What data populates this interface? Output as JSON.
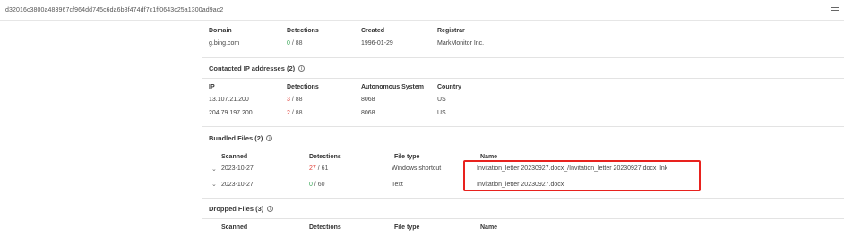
{
  "header": {
    "hash": "d32016c3800a483967cf964dd745c6da6b8f474df7c1ff0643c25a1300ad9ac2",
    "menu_icon": "hamburger-menu-icon"
  },
  "domain_table": {
    "headers": [
      "Domain",
      "Detections",
      "Created",
      "Registrar"
    ],
    "rows": [
      {
        "domain": "g.bing.com",
        "det_count": "0",
        "det_total": "/ 88",
        "created": "1996-01-29",
        "registrar": "MarkMonitor Inc."
      }
    ]
  },
  "contacted_ips": {
    "title": "Contacted IP addresses (2)",
    "headers": [
      "IP",
      "Detections",
      "Autonomous System",
      "Country"
    ],
    "rows": [
      {
        "ip": "13.107.21.200",
        "det_count": "3",
        "det_total": "/ 88",
        "asn": "8068",
        "country": "US"
      },
      {
        "ip": "204.79.197.200",
        "det_count": "2",
        "det_total": "/ 88",
        "asn": "8068",
        "country": "US"
      }
    ]
  },
  "bundled_files": {
    "title": "Bundled Files (2)",
    "headers": [
      "Scanned",
      "Detections",
      "File type",
      "Name"
    ],
    "rows": [
      {
        "scanned": "2023-10-27",
        "det_count": "27",
        "det_total": "/ 61",
        "file_type": "Windows shortcut",
        "name": "Invitation_letter 20230927.docx_/Invitation_letter 20230927.docx .lnk"
      },
      {
        "scanned": "2023-10-27",
        "det_count": "0",
        "det_total": "/ 60",
        "file_type": "Text",
        "name": "Invitation_letter 20230927.docx"
      }
    ]
  },
  "dropped_files": {
    "title": "Dropped Files (3)",
    "headers": [
      "Scanned",
      "Detections",
      "File type",
      "Name"
    ]
  },
  "colors": {
    "malicious": "#e0413a",
    "clean": "#3aa657",
    "highlight": "#e8221e"
  }
}
